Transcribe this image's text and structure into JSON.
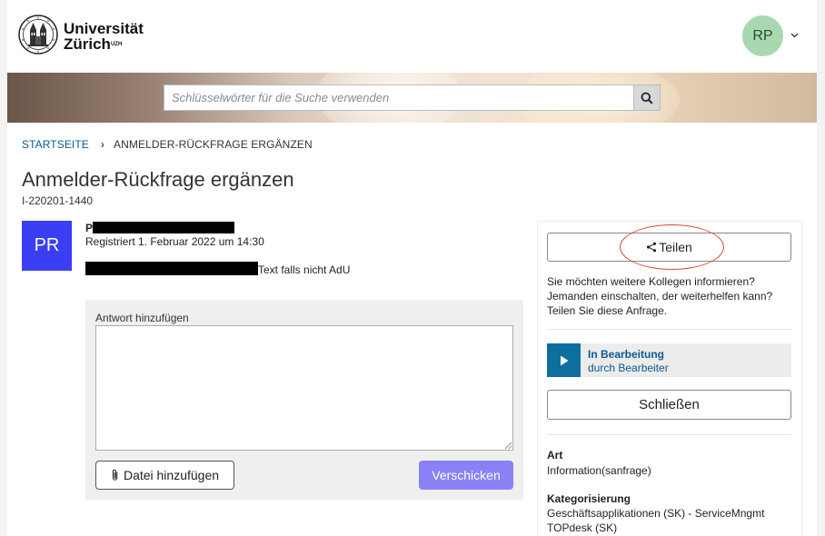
{
  "header": {
    "logo_line1": "Universität",
    "logo_line2": "Zürich",
    "logo_superscript": "UZH",
    "user_initials": "RP"
  },
  "search": {
    "placeholder": "Schlüsselwörter für die Suche verwenden",
    "icon": "search-icon"
  },
  "breadcrumb": {
    "home": "STARTSEITE",
    "separator": "›",
    "current": "ANMELDER-RÜCKFRAGE ERGÄNZEN"
  },
  "page": {
    "title": "Anmelder-Rückfrage ergänzen",
    "ticket_id": "I-220201-1440"
  },
  "message": {
    "avatar_initials": "PR",
    "requester_initial": "P",
    "registered": "Registriert 1. Februar 2022 um 14:30",
    "text": "Text falls nicht AdU"
  },
  "reply": {
    "label": "Antwort hinzufügen",
    "value": "",
    "attach_label": "Datei hinzufügen",
    "send_label": "Verschicken"
  },
  "sidebar": {
    "share_label": "Teilen",
    "share_info": "Sie möchten weitere Kollegen informieren? Jemanden einschalten, der weiterhelfen kann? Teilen Sie diese Anfrage.",
    "status_title": "In Bearbeitung",
    "status_sub": "durch Bearbeiter",
    "close_label": "Schließen",
    "art_label": "Art",
    "art_value": "Information(sanfrage)",
    "category_label": "Kategorisierung",
    "category_value": "Geschäftsapplikationen (SK) - ServiceMngmt TOPdesk (SK)"
  },
  "colors": {
    "brand_link": "#0b5a8f",
    "avatar_bg": "#a8d8b0",
    "pr_badge": "#3b3ef5",
    "send_button": "#8a81f7",
    "status_play": "#0e6e9e",
    "annotation": "#d84b3a"
  }
}
